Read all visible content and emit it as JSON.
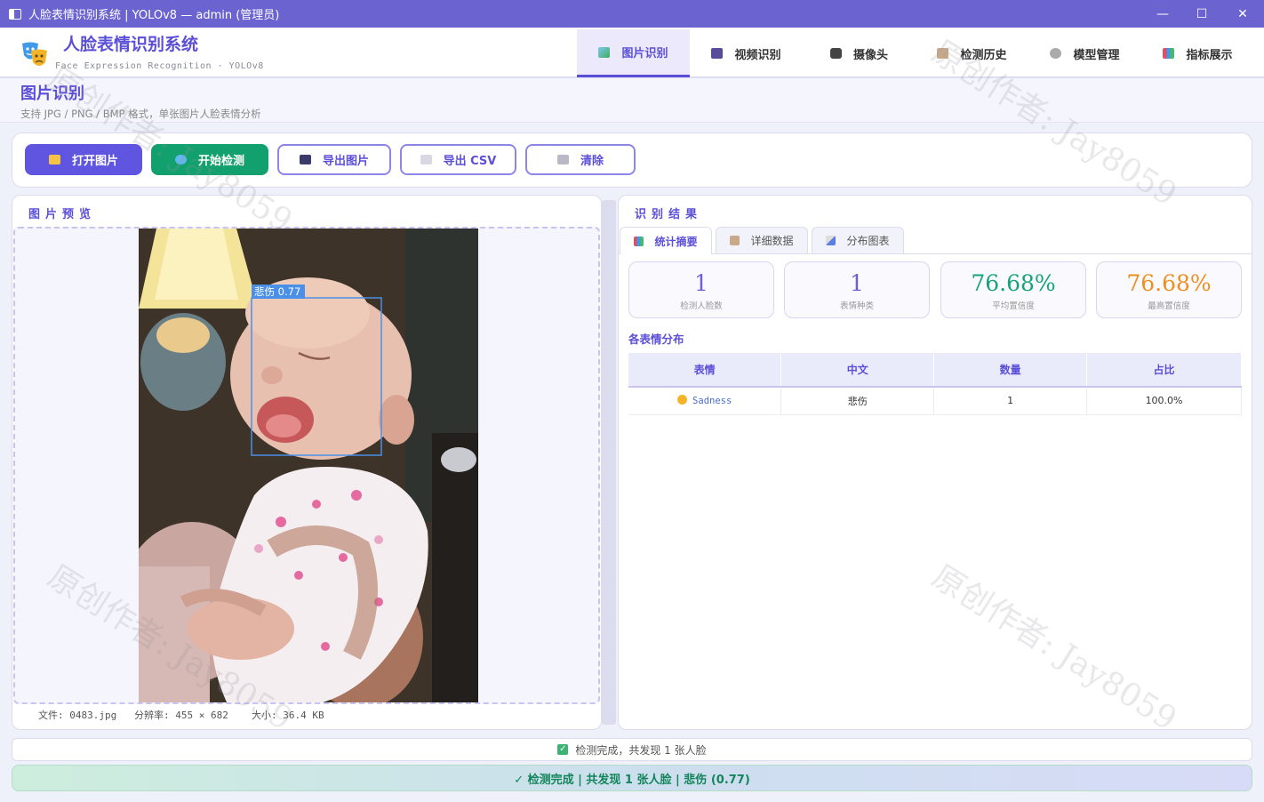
{
  "window": {
    "title": "人脸表情识别系统 | YOLOv8 — admin (管理员)",
    "controls": {
      "minimize": "—",
      "maximize": "☐",
      "close": "✕"
    }
  },
  "app": {
    "title": "人脸表情识别系统",
    "subtitle": "Face Expression Recognition  ·  YOLOv8"
  },
  "nav": {
    "tabs": [
      {
        "label": "图片识别",
        "icon": "image-icon"
      },
      {
        "label": "视频识别",
        "icon": "video-icon"
      },
      {
        "label": "摄像头",
        "icon": "camera-icon"
      },
      {
        "label": "检测历史",
        "icon": "history-icon"
      },
      {
        "label": "模型管理",
        "icon": "gear-icon"
      },
      {
        "label": "指标展示",
        "icon": "bar-chart-icon"
      }
    ],
    "active": "图片识别"
  },
  "page": {
    "title": "图片识别",
    "subtitle": "支持 JPG / PNG / BMP 格式，单张图片人脸表情分析"
  },
  "toolbar": {
    "open": "打开图片",
    "detect": "开始检测",
    "export_image": "导出图片",
    "export_csv": "导出 CSV",
    "clear": "清除"
  },
  "preview": {
    "title": "图片预览",
    "detection_label": "悲伤 0.77",
    "file_label": "文件: 0483.jpg",
    "resolution_label": "分辨率: 455 × 682",
    "size_label": "大小: 36.4 KB"
  },
  "results": {
    "title": "识别结果",
    "tabs": [
      {
        "label": "统计摘要",
        "icon": "bar-chart-icon"
      },
      {
        "label": "详细数据",
        "icon": "document-icon"
      },
      {
        "label": "分布图表",
        "icon": "line-chart-icon"
      }
    ],
    "cards": [
      {
        "value": "1",
        "label": "检测人脸数",
        "color": "#6f5fd6"
      },
      {
        "value": "1",
        "label": "表情种类",
        "color": "#6f5fd6"
      },
      {
        "value": "76.68%",
        "label": "平均置信度",
        "color": "#16a37c"
      },
      {
        "value": "76.68%",
        "label": "最高置信度",
        "color": "#ef8f1f"
      }
    ],
    "distribution_title": "各表情分布",
    "table": {
      "headers": [
        "表情",
        "中文",
        "数量",
        "占比"
      ],
      "rows": [
        {
          "expression": "Sadness",
          "chinese": "悲伤",
          "count": "1",
          "ratio": "100.0%"
        }
      ]
    }
  },
  "status": {
    "line": "检测完成，共发现 1 张人脸",
    "banner": "✓  检测完成  |  共发现 1 张人脸  |  悲伤 (0.77)"
  },
  "watermark": "原创作者: Jay8059",
  "colors": {
    "accent": "#5b4fd8",
    "titlebar": "#6b63cf",
    "success": "#12a06e",
    "detection_box": "#4a8fe8"
  }
}
